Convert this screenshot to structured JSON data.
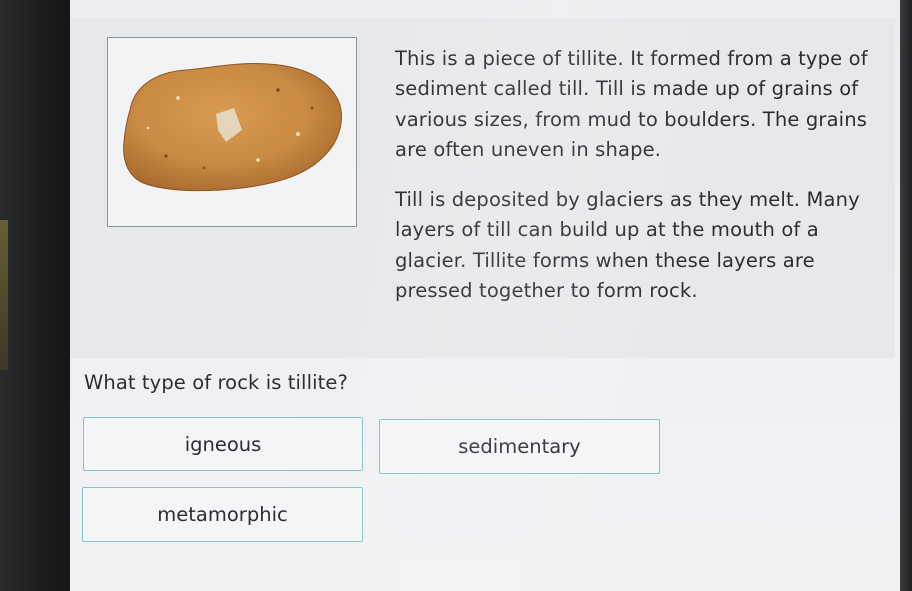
{
  "passage": {
    "image_alt": "tillite-rock-photo",
    "paragraph_1": "This is a piece of tillite. It formed from a type of sediment called till. Till is made up of grains of various sizes, from mud to boulders. The grains are often uneven in shape.",
    "paragraph_2": "Till is deposited by glaciers as they melt. Many layers of till can build up at the mouth of a glacier. Tillite forms when these layers are pressed together to form rock."
  },
  "question": {
    "prompt": "What type of rock is tillite?",
    "choices": [
      {
        "label": "igneous"
      },
      {
        "label": "sedimentary"
      },
      {
        "label": "metamorphic"
      }
    ]
  },
  "colors": {
    "choice_border": "#86c3cc",
    "rock": "#c98a44",
    "text": "#2c2d30"
  }
}
